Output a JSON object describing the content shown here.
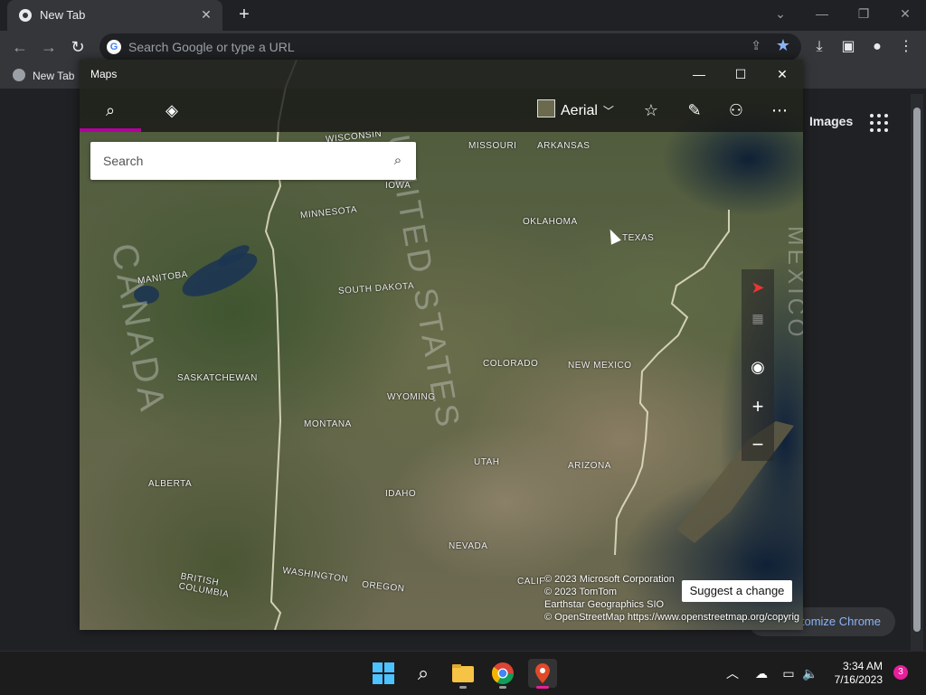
{
  "browser": {
    "tab_title": "New Tab",
    "omnibox_placeholder": "Search Google or type a URL",
    "bookmark": "New Tab",
    "images_link": "Images",
    "customize_label": "Customize Chrome"
  },
  "maps": {
    "app_title": "Maps",
    "map_style": "Aerial",
    "search_placeholder": "Search",
    "suggest_change": "Suggest a change",
    "copyright": [
      "© 2023 Microsoft Corporation",
      "© 2023 TomTom",
      "Earthstar Geographics  SIO",
      "© OpenStreetMap https://www.openstreetmap.org/copyrig"
    ],
    "country_labels": [
      "CANADA",
      "UNITED STATES",
      "MEXICO"
    ],
    "region_labels": [
      "WISCONSIN",
      "MISSOURI",
      "ARKANSAS",
      "IOWA",
      "MINNESOTA",
      "OKLAHOMA",
      "TEXAS",
      "MANITOBA",
      "SOUTH DAKOTA",
      "COLORADO",
      "NEW MEXICO",
      "SASKATCHEWAN",
      "WYOMING",
      "MONTANA",
      "UTAH",
      "ARIZONA",
      "ALBERTA",
      "IDAHO",
      "NEVADA",
      "BRITISH COLUMBIA",
      "WASHINGTON",
      "OREGON",
      "CALIF"
    ]
  },
  "taskbar": {
    "time": "3:34 AM",
    "date": "7/16/2023",
    "notification_count": "3"
  },
  "colors": {
    "accent_underline": "#b4009e",
    "bookmark_star": "#8ab4f8",
    "notification_badge": "#e81e9b"
  },
  "icons": [
    "chrome-icon",
    "close-icon",
    "plus-icon",
    "back-icon",
    "forward-icon",
    "reload-icon",
    "share-icon",
    "star-icon",
    "download-icon",
    "sidepanel-icon",
    "profile-icon",
    "menu-icon",
    "search-icon",
    "directions-icon",
    "favorites-icon",
    "ink-icon",
    "account-icon",
    "more-icon",
    "compass-icon",
    "locate-icon",
    "zoom-in-icon",
    "zoom-out-icon",
    "windows-icon",
    "folder-icon",
    "maps-icon",
    "chevron-up-icon",
    "network-icon",
    "volume-icon"
  ]
}
